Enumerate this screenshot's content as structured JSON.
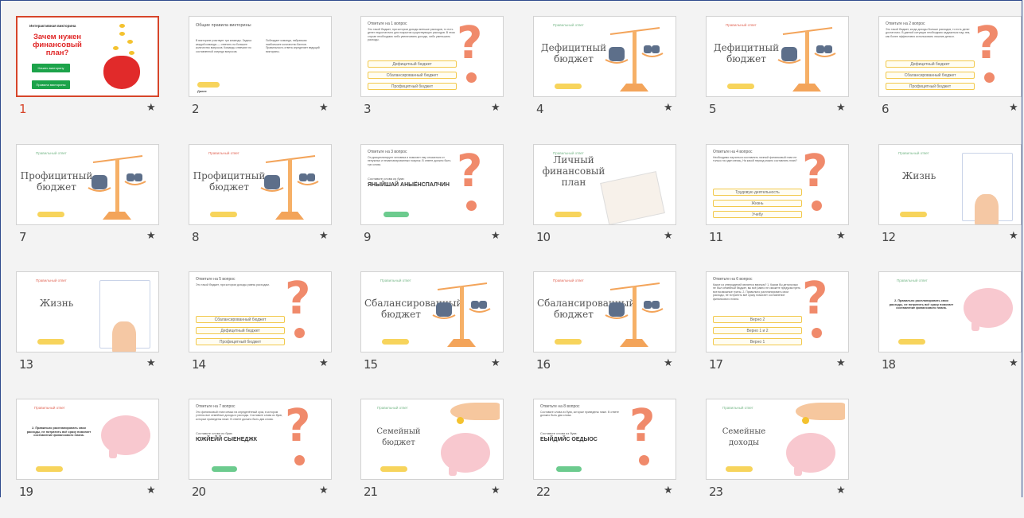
{
  "colors": {
    "selection": "#d7452a",
    "accent_red": "#e02828",
    "accent_orange": "#f08a6b",
    "accent_yellow": "#f7d45c",
    "accent_green": "#6ccb8e"
  },
  "slides": [
    {
      "number": "1",
      "type": "cover",
      "title": "Интерактивная викторина",
      "heading": "Зачем нужен финансовый план?",
      "btn1": "Начать викторину",
      "btn2": "Правила викторины",
      "selected": true,
      "icon": "purse-icon"
    },
    {
      "number": "2",
      "type": "rules",
      "title": "Общие правила викторины",
      "left_text": "В викторине участвует три команды. Задача каждой команды — ответить на большее количество вопросов. Команды отвечают по составленной очереди вопросов.",
      "right_text": "Побеждает команда, набравшая наибольшее количество баллов. Правильность ответа определяет ведущий викторины.",
      "button": "Далее"
    },
    {
      "number": "3",
      "type": "question",
      "title": "Ответьте на 1 вопрос",
      "text": "Это такой бюджет, при котором доходы меньше расходов, то есть денег недостаточно для покрытия существующих расходов. В этом случае необходимо либо увеличивать доходы, либо уменьшать расходы.",
      "options": [
        "Дефицитный бюджет",
        "Сбалансированный бюджет",
        "Профицитный бюджет"
      ]
    },
    {
      "number": "4",
      "type": "answer",
      "header": "Правильный ответ",
      "header_color": "green",
      "answer": "Дефицитный бюджет",
      "image": "scale-icon"
    },
    {
      "number": "5",
      "type": "answer",
      "header": "Правильный ответ",
      "header_color": "red",
      "answer": "Дефицитный бюджет",
      "image": "scale-icon"
    },
    {
      "number": "6",
      "type": "question",
      "title": "Ответьте на 2 вопрос",
      "text": "Это такой бюджет, когда доходы больше расходов, то есть денег достаточно. В данной ситуации необходимо задуматься над тем, как более эффективно использовать лишние деньги.",
      "options": [
        "Дефицитный бюджет",
        "Сбалансированный бюджет",
        "Профицитный бюджет"
      ]
    },
    {
      "number": "7",
      "type": "answer",
      "header": "Правильный ответ",
      "header_color": "green",
      "answer": "Профицитный бюджет",
      "image": "scale-icon"
    },
    {
      "number": "8",
      "type": "answer",
      "header": "Правильный ответ",
      "header_color": "red",
      "answer": "Профицитный бюджет",
      "image": "scale-icon"
    },
    {
      "number": "9",
      "type": "scramble",
      "title": "Ответьте на 3 вопрос",
      "text": "Он дисциплинирует человека и помогает ему отказаться от ненужных и незапланированных покупок. В ответе должно быть три слова.",
      "prompt": "Составьте слова из букв:",
      "scramble": "ЯНЫЙШАЙ АНЫЁНСПАЛЧИН",
      "button": "Далее"
    },
    {
      "number": "10",
      "type": "answer",
      "header": "Правильный ответ",
      "header_color": "green",
      "answer": "Личный финансовый план",
      "image": "document-icon"
    },
    {
      "number": "11",
      "type": "question",
      "title": "Ответьте на 4 вопрос",
      "text": "Необходимо научиться составлять личный финансовый план не только на один месяц. На какой период можно составлять план?",
      "options": [
        "Трудовую деятельность",
        "Жизнь",
        "Учебу"
      ]
    },
    {
      "number": "12",
      "type": "answer",
      "header": "Правильный ответ",
      "header_color": "green",
      "answer": "Жизнь",
      "image": "diagram-hand-icon"
    },
    {
      "number": "13",
      "type": "answer",
      "header": "Правильный ответ",
      "header_color": "red",
      "answer": "Жизнь",
      "image": "diagram-hand-icon"
    },
    {
      "number": "14",
      "type": "question",
      "title": "Ответьте на 5 вопрос",
      "text": "Это такой бюджет, при котором доходы равны расходам.",
      "options": [
        "Сбалансированный бюджет",
        "Дефицитный бюджет",
        "Профицитный бюджет"
      ]
    },
    {
      "number": "15",
      "type": "answer",
      "header": "Правильный ответ",
      "header_color": "green",
      "answer": "Сбалансированный бюджет",
      "image": "scale-icon"
    },
    {
      "number": "16",
      "type": "answer",
      "header": "Правильный ответ",
      "header_color": "red",
      "answer": "Сбалансированный бюджет",
      "image": "scale-icon"
    },
    {
      "number": "17",
      "type": "question",
      "title": "Ответьте на 6 вопрос",
      "text": "Какое из утверждений является верным? 1. Каким бы детальным не был семейный бюджет, вы всё равно не сможете предусмотреть все возможные траты. 2. Правильно распланировать свои расходы, не потратить всё сразу помогает составление финансового плана.",
      "options": [
        "Верно 2",
        "Верно 1 и 2",
        "Верно 1"
      ]
    },
    {
      "number": "18",
      "type": "piggy",
      "header": "Правильный ответ",
      "header_color": "green",
      "answer": "2. Правильно распланировать свои расходы, не потратить всё сразу помогает составление финансового плана."
    },
    {
      "number": "19",
      "type": "piggy",
      "header": "Правильный ответ",
      "header_color": "red",
      "answer": "2. Правильно распланировать свои расходы, не потратить всё сразу помогает составление финансового плана."
    },
    {
      "number": "20",
      "type": "scramble",
      "title": "Ответьте на 7 вопрос",
      "text": "Это финансовый план семьи на определённый срок, в котором учтены все семейные доходы и расходы. Составьте слова из букв, которые приведены ниже. В ответе должно быть два слова.",
      "prompt": "Составьте слова из букв:",
      "scramble": "ЮЖЙЕЙЙ СЫЕНЕДЖК",
      "button": "Далее"
    },
    {
      "number": "21",
      "type": "coin",
      "header": "Правильный ответ",
      "header_color": "green",
      "answer": "Семейный бюджет"
    },
    {
      "number": "22",
      "type": "scramble",
      "title": "Ответьте на 8 вопрос",
      "text": "Составьте слова из букв, которые приведены ниже. В ответе должно быть два слова.",
      "prompt": "Составьте слова из букв:",
      "scramble": "ЕЫЙДМЙС ОЕДЫОС",
      "button": "Далее"
    },
    {
      "number": "23",
      "type": "coin",
      "header": "Правильный ответ",
      "header_color": "green",
      "answer": "Семейные доходы"
    }
  ],
  "star_glyph": "★"
}
